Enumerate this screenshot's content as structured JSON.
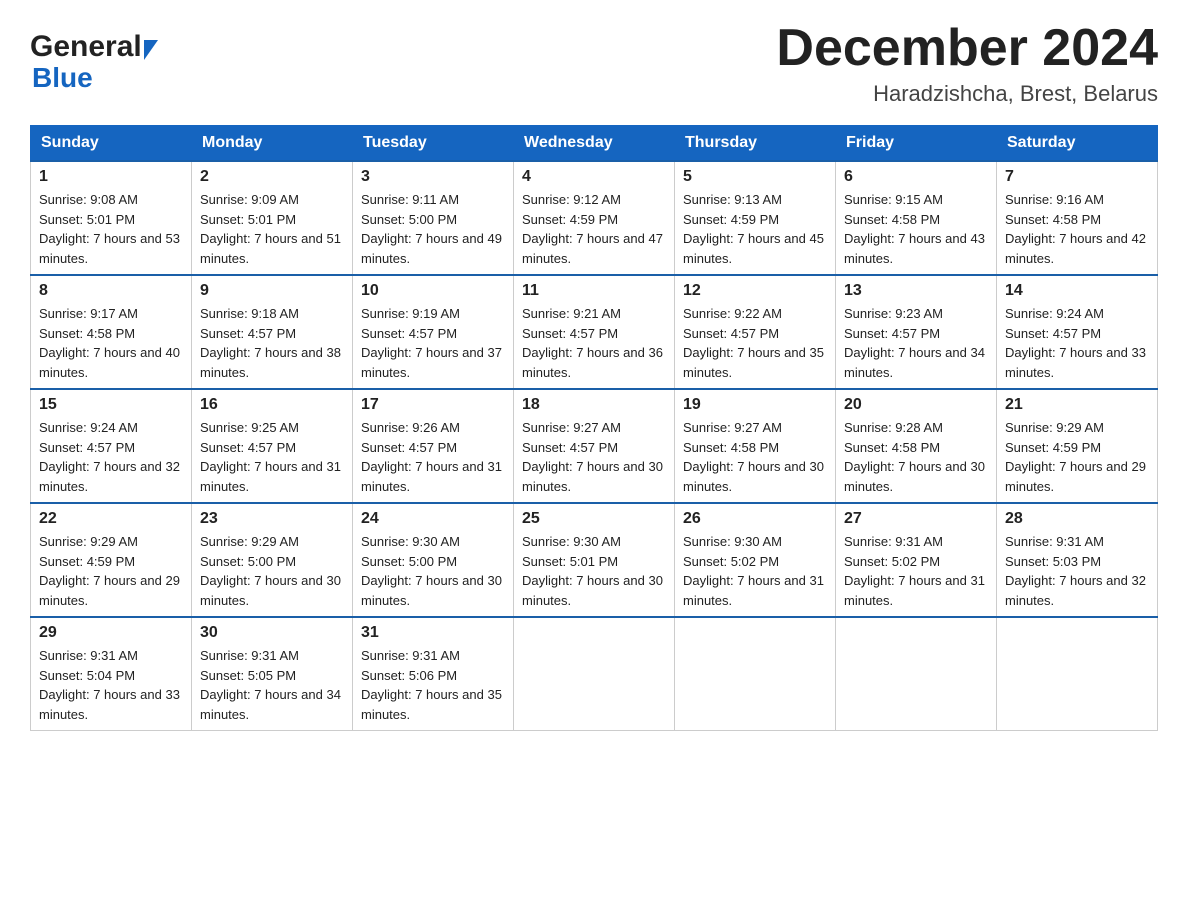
{
  "header": {
    "logo_general": "General",
    "logo_blue": "Blue",
    "month_title": "December 2024",
    "location": "Haradzishcha, Brest, Belarus"
  },
  "days_of_week": [
    "Sunday",
    "Monday",
    "Tuesday",
    "Wednesday",
    "Thursday",
    "Friday",
    "Saturday"
  ],
  "weeks": [
    [
      {
        "day": "1",
        "sunrise": "9:08 AM",
        "sunset": "5:01 PM",
        "daylight": "7 hours and 53 minutes."
      },
      {
        "day": "2",
        "sunrise": "9:09 AM",
        "sunset": "5:01 PM",
        "daylight": "7 hours and 51 minutes."
      },
      {
        "day": "3",
        "sunrise": "9:11 AM",
        "sunset": "5:00 PM",
        "daylight": "7 hours and 49 minutes."
      },
      {
        "day": "4",
        "sunrise": "9:12 AM",
        "sunset": "4:59 PM",
        "daylight": "7 hours and 47 minutes."
      },
      {
        "day": "5",
        "sunrise": "9:13 AM",
        "sunset": "4:59 PM",
        "daylight": "7 hours and 45 minutes."
      },
      {
        "day": "6",
        "sunrise": "9:15 AM",
        "sunset": "4:58 PM",
        "daylight": "7 hours and 43 minutes."
      },
      {
        "day": "7",
        "sunrise": "9:16 AM",
        "sunset": "4:58 PM",
        "daylight": "7 hours and 42 minutes."
      }
    ],
    [
      {
        "day": "8",
        "sunrise": "9:17 AM",
        "sunset": "4:58 PM",
        "daylight": "7 hours and 40 minutes."
      },
      {
        "day": "9",
        "sunrise": "9:18 AM",
        "sunset": "4:57 PM",
        "daylight": "7 hours and 38 minutes."
      },
      {
        "day": "10",
        "sunrise": "9:19 AM",
        "sunset": "4:57 PM",
        "daylight": "7 hours and 37 minutes."
      },
      {
        "day": "11",
        "sunrise": "9:21 AM",
        "sunset": "4:57 PM",
        "daylight": "7 hours and 36 minutes."
      },
      {
        "day": "12",
        "sunrise": "9:22 AM",
        "sunset": "4:57 PM",
        "daylight": "7 hours and 35 minutes."
      },
      {
        "day": "13",
        "sunrise": "9:23 AM",
        "sunset": "4:57 PM",
        "daylight": "7 hours and 34 minutes."
      },
      {
        "day": "14",
        "sunrise": "9:24 AM",
        "sunset": "4:57 PM",
        "daylight": "7 hours and 33 minutes."
      }
    ],
    [
      {
        "day": "15",
        "sunrise": "9:24 AM",
        "sunset": "4:57 PM",
        "daylight": "7 hours and 32 minutes."
      },
      {
        "day": "16",
        "sunrise": "9:25 AM",
        "sunset": "4:57 PM",
        "daylight": "7 hours and 31 minutes."
      },
      {
        "day": "17",
        "sunrise": "9:26 AM",
        "sunset": "4:57 PM",
        "daylight": "7 hours and 31 minutes."
      },
      {
        "day": "18",
        "sunrise": "9:27 AM",
        "sunset": "4:57 PM",
        "daylight": "7 hours and 30 minutes."
      },
      {
        "day": "19",
        "sunrise": "9:27 AM",
        "sunset": "4:58 PM",
        "daylight": "7 hours and 30 minutes."
      },
      {
        "day": "20",
        "sunrise": "9:28 AM",
        "sunset": "4:58 PM",
        "daylight": "7 hours and 30 minutes."
      },
      {
        "day": "21",
        "sunrise": "9:29 AM",
        "sunset": "4:59 PM",
        "daylight": "7 hours and 29 minutes."
      }
    ],
    [
      {
        "day": "22",
        "sunrise": "9:29 AM",
        "sunset": "4:59 PM",
        "daylight": "7 hours and 29 minutes."
      },
      {
        "day": "23",
        "sunrise": "9:29 AM",
        "sunset": "5:00 PM",
        "daylight": "7 hours and 30 minutes."
      },
      {
        "day": "24",
        "sunrise": "9:30 AM",
        "sunset": "5:00 PM",
        "daylight": "7 hours and 30 minutes."
      },
      {
        "day": "25",
        "sunrise": "9:30 AM",
        "sunset": "5:01 PM",
        "daylight": "7 hours and 30 minutes."
      },
      {
        "day": "26",
        "sunrise": "9:30 AM",
        "sunset": "5:02 PM",
        "daylight": "7 hours and 31 minutes."
      },
      {
        "day": "27",
        "sunrise": "9:31 AM",
        "sunset": "5:02 PM",
        "daylight": "7 hours and 31 minutes."
      },
      {
        "day": "28",
        "sunrise": "9:31 AM",
        "sunset": "5:03 PM",
        "daylight": "7 hours and 32 minutes."
      }
    ],
    [
      {
        "day": "29",
        "sunrise": "9:31 AM",
        "sunset": "5:04 PM",
        "daylight": "7 hours and 33 minutes."
      },
      {
        "day": "30",
        "sunrise": "9:31 AM",
        "sunset": "5:05 PM",
        "daylight": "7 hours and 34 minutes."
      },
      {
        "day": "31",
        "sunrise": "9:31 AM",
        "sunset": "5:06 PM",
        "daylight": "7 hours and 35 minutes."
      },
      null,
      null,
      null,
      null
    ]
  ]
}
